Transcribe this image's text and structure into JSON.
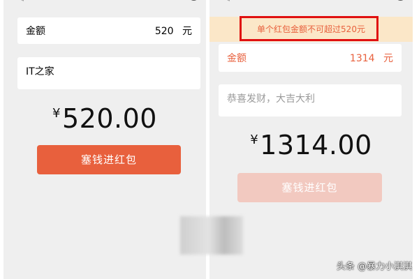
{
  "left": {
    "amount_label": "金额",
    "amount_value": "520",
    "unit": "元",
    "message": "IT之家",
    "currency": "¥",
    "big_amount": "520.00",
    "send_button": "塞钱进红包"
  },
  "right": {
    "error_message": "单个红包金额不可超过520元",
    "amount_label": "金额",
    "amount_value": "1314",
    "unit": "元",
    "message_placeholder": "恭喜发财，大吉大利",
    "currency": "¥",
    "big_amount": "1314.00",
    "send_button": "塞钱进红包",
    "send_button_enabled": false
  },
  "watermark": "头条 @暴力小淇淇",
  "colors": {
    "accent": "#e8603d",
    "accent_disabled": "#f2c9c0",
    "warning_bg": "#fbe7c8",
    "highlight_border": "#e01010",
    "page_bg": "#efefef"
  }
}
